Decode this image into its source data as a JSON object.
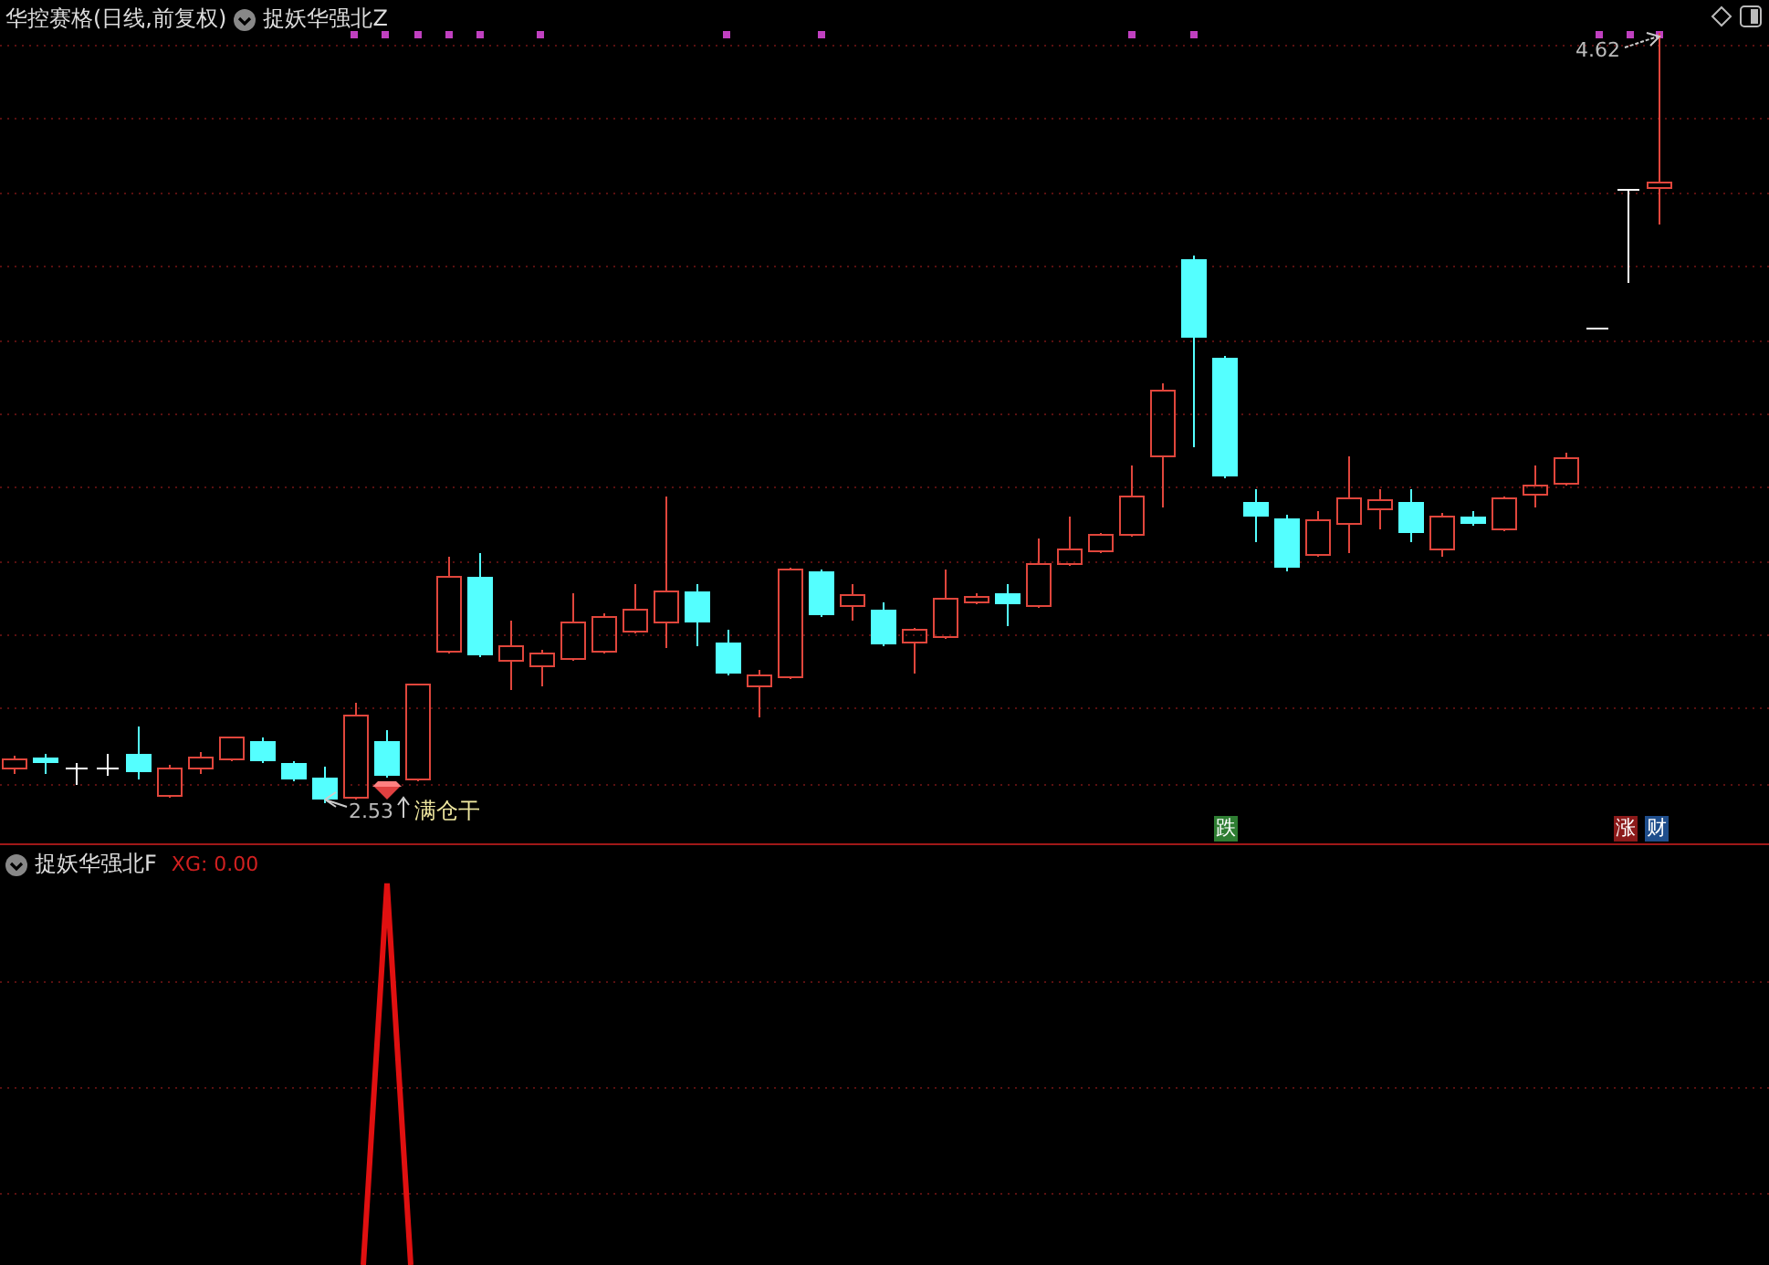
{
  "main_chart": {
    "title": "华控赛格(日线,前复权)",
    "indicator": "捉妖华强北Z",
    "high_label": "4.62",
    "low_label": "2.53",
    "signal_text": "满仓干",
    "tags": [
      {
        "text": "跌",
        "color": "#2e7d32"
      },
      {
        "text": "涨",
        "color": "#8b1a1a"
      },
      {
        "text": "财",
        "color": "#1f4e8c"
      }
    ]
  },
  "sub_chart": {
    "indicator": "捉妖华强北F",
    "reading": "XG: 0.00"
  }
}
